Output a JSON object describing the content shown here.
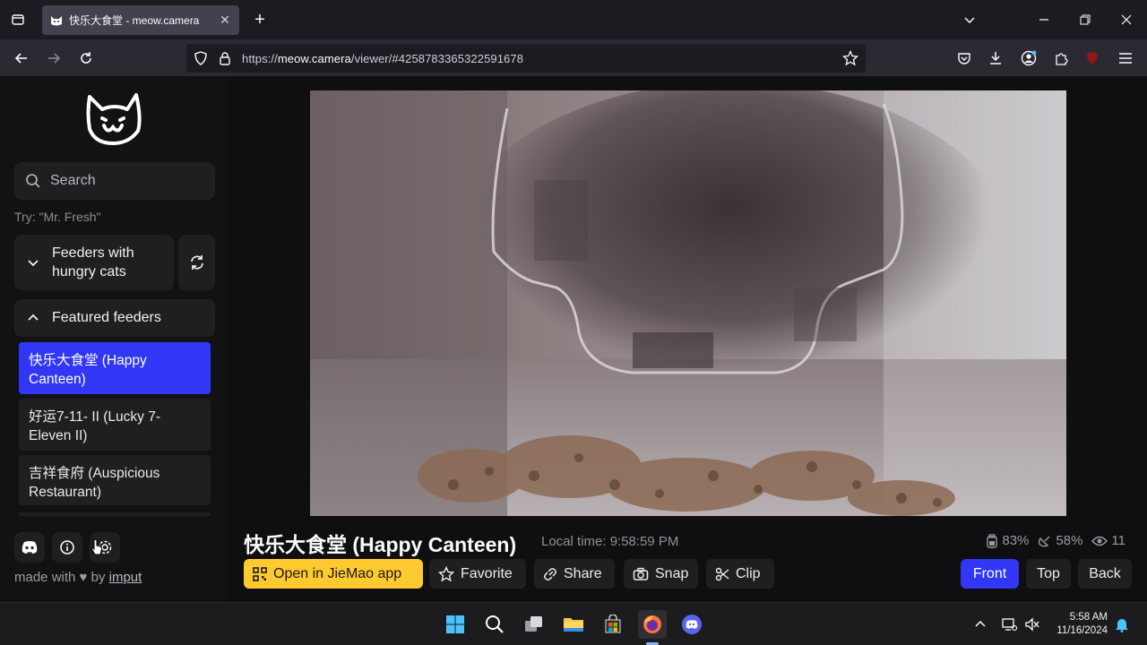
{
  "browser": {
    "tab_title": "快乐大食堂 - meow.camera",
    "url_prefix": "https://",
    "url_host": "meow.camera",
    "url_path": "/viewer/#4258783365322591678"
  },
  "sidebar": {
    "search_placeholder": "Search",
    "try_hint": "Try: \"Mr. Fresh\"",
    "group_hungry": "Feeders with hungry cats",
    "group_featured": "Featured feeders",
    "feeders": [
      {
        "label": "快乐大食堂 (Happy Canteen)",
        "active": true
      },
      {
        "label": "好运7-11- II  (Lucky 7-Eleven II)",
        "active": false
      },
      {
        "label": "吉祥食府 (Auspicious Restaurant)",
        "active": false
      }
    ],
    "made_with_prefix": "made with",
    "made_with_by": "by",
    "made_with_link": "imput"
  },
  "viewer": {
    "title": "快乐大食堂 (Happy Canteen)",
    "local_time": "Local time: 9:58:59 PM",
    "food_level": "83%",
    "secondary_level": "58%",
    "viewers": "11"
  },
  "actions": {
    "open_app": "Open in JieMao app",
    "favorite": "Favorite",
    "share": "Share",
    "snap": "Snap",
    "clip": "Clip",
    "front": "Front",
    "top": "Top",
    "back": "Back"
  },
  "taskbar": {
    "time": "5:58 AM",
    "date": "11/16/2024"
  },
  "colors": {
    "accent_blue": "#3137f5",
    "accent_yellow": "#ffc930"
  }
}
